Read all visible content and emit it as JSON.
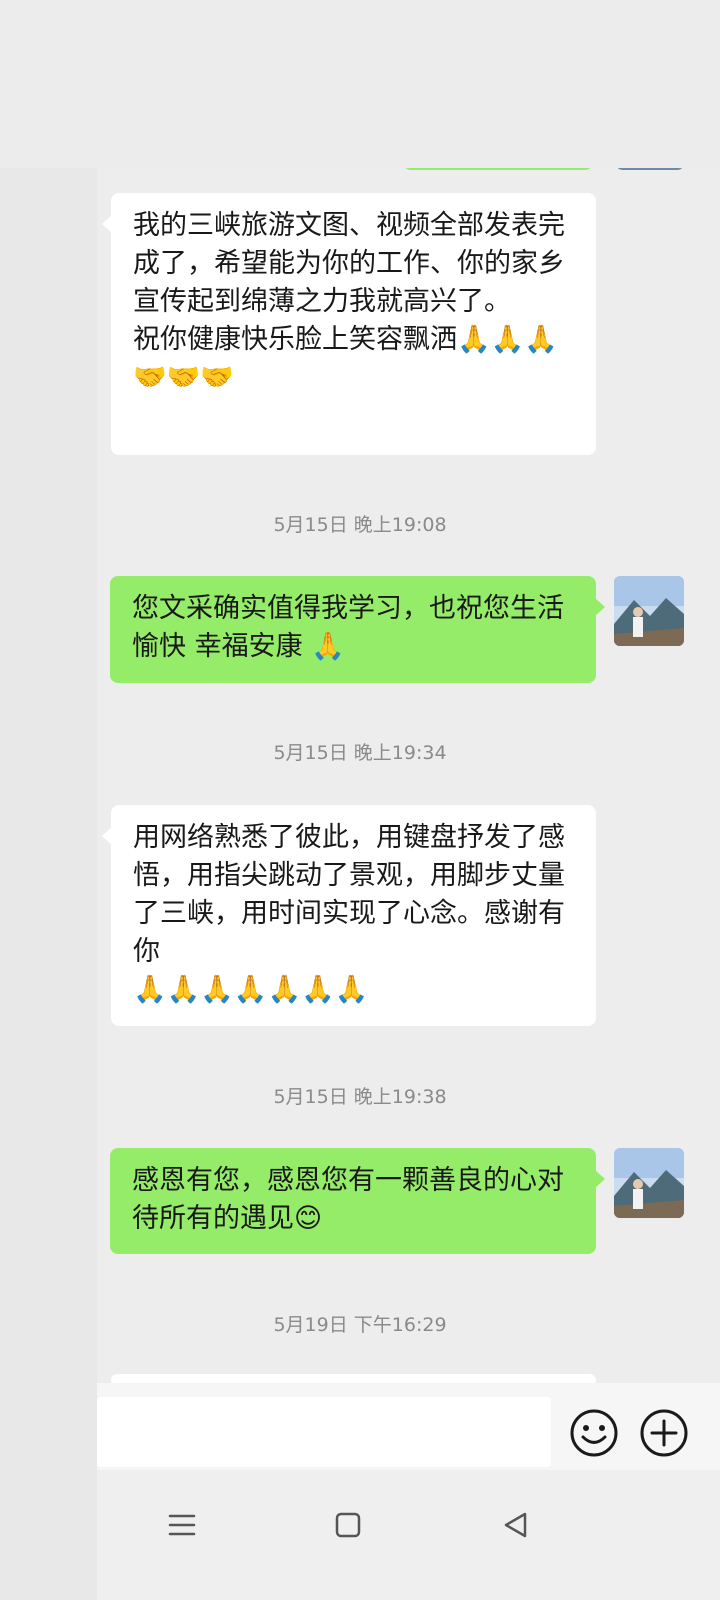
{
  "messages": [
    {
      "id": "m1",
      "side": "in",
      "text": "我的三峡旅游文图、视频全部发表完成了，希望能为你的工作、你的家乡宣传起到绵薄之力我就高兴了。\n祝你健康快乐脸上笑容飘洒🙏🙏🙏🤝🤝🤝"
    },
    {
      "id": "t1",
      "side": "time",
      "text": "5月15日 晚上19:08"
    },
    {
      "id": "m2",
      "side": "out",
      "text": "您文采确实值得我学习，也祝您生活愉快 幸福安康 🙏"
    },
    {
      "id": "t2",
      "side": "time",
      "text": "5月15日 晚上19:34"
    },
    {
      "id": "m3",
      "side": "in",
      "text": "用网络熟悉了彼此，用键盘抒发了感悟，用指尖跳动了景观，用脚步丈量了三峡，用时间实现了心念。感谢有你\n🙏🙏🙏🙏🙏🙏🙏"
    },
    {
      "id": "t3",
      "side": "time",
      "text": "5月15日 晚上19:38"
    },
    {
      "id": "m4",
      "side": "out",
      "text": "感恩有您，感恩您有一颗善良的心对待所有的遇见😊"
    },
    {
      "id": "t4",
      "side": "time",
      "text": "5月19日 下午16:29"
    }
  ],
  "input": {
    "value": "",
    "placeholder": ""
  },
  "icons": {
    "emoji": "emoji-icon",
    "plus": "plus-icon",
    "menu": "menu-icon",
    "home": "home-icon",
    "back": "back-icon",
    "avatar": "avatar-image"
  },
  "colors": {
    "outgoing_bubble": "#95ec69",
    "incoming_bubble": "#ffffff",
    "background": "#ededed",
    "timestamp": "#8a8a8a"
  }
}
